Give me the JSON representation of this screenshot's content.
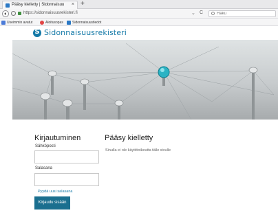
{
  "browser": {
    "tab_title": "Pääsy kielletty | Sidonnaisuu",
    "tab_close": "×",
    "new_tab": "+",
    "url": "https://sidonnaisuusrekisteri.fi",
    "url_dropdown": "⌄",
    "reload": "C",
    "search_placeholder": "Haku",
    "bookmarks": [
      {
        "label": "Useimmin avatut"
      },
      {
        "label": "Aloitusopas"
      },
      {
        "label": "Sidonnaisuustiedot"
      }
    ]
  },
  "site": {
    "title": "Sidonnaisuusrekisteri",
    "brand_color": "#1479a7"
  },
  "login": {
    "heading": "Kirjautuminen",
    "email_label": "Sähköposti",
    "password_label": "Salasana",
    "forgot_link": "Pyydä uusi salasana",
    "submit_label": "Kirjaudu sisään",
    "button_color": "#1a6f8f"
  },
  "access_denied": {
    "heading": "Pääsy kielletty",
    "message": "Sinulla ei ole käyttöoikeutta tälle sivulle"
  }
}
